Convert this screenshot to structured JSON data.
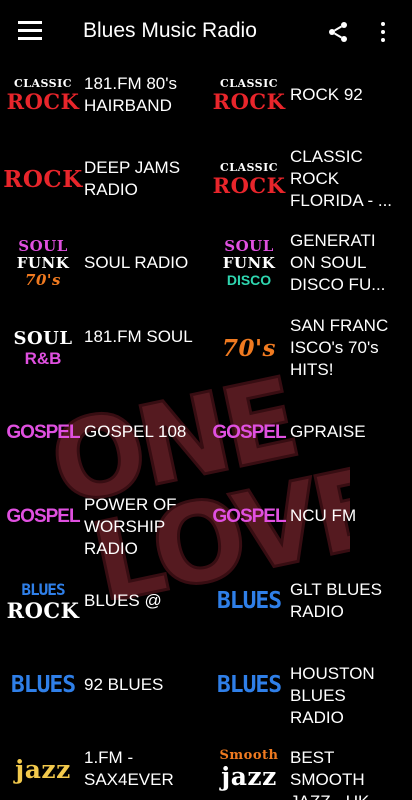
{
  "app": {
    "title": "Blues Music Radio"
  },
  "icons": {
    "menu": "hamburger-menu-icon",
    "share": "share-icon",
    "more": "more-vert-icon"
  },
  "watermark": {
    "text": "ONE LOVE"
  },
  "stations": [
    {
      "name": "181.FM 80's HAIRBAND",
      "logo": [
        "CLASSIC",
        "ROCK"
      ],
      "colors": [
        "#ffffff",
        "#e8252b"
      ]
    },
    {
      "name": "ROCK 92",
      "logo": [
        "CLASSIC",
        "ROCK"
      ],
      "colors": [
        "#ffffff",
        "#e8252b"
      ]
    },
    {
      "name": "DEEP JAMS RADIO",
      "logo": [
        "ROCK"
      ],
      "colors": [
        "#e8252b"
      ]
    },
    {
      "name": "CLASSIC ROCK FLORIDA - ...",
      "logo": [
        "CLASSIC",
        "ROCK"
      ],
      "colors": [
        "#ffffff",
        "#e8252b"
      ]
    },
    {
      "name": "SOUL RADIO",
      "logo": [
        "SOUL",
        "FUNK",
        "70's"
      ],
      "colors": [
        "#e050e0",
        "#ffffff",
        "#f07a20"
      ]
    },
    {
      "name": "GENERATI ON SOUL DISCO FU...",
      "logo": [
        "SOUL",
        "FUNK",
        "DISCO"
      ],
      "colors": [
        "#e050e0",
        "#ffffff",
        "#2fd6b0"
      ]
    },
    {
      "name": "181.FM SOUL",
      "logo": [
        "SOUL",
        "R&B"
      ],
      "colors": [
        "#ffffff",
        "#e050e0"
      ]
    },
    {
      "name": "SAN FRANC ISCO's 70's HITS!",
      "logo": [
        "70's"
      ],
      "colors": [
        "#f07a20"
      ]
    },
    {
      "name": "GOSPEL 108",
      "logo": [
        "GOSPEL"
      ],
      "colors": [
        "#e050e0"
      ]
    },
    {
      "name": "GPRAISE",
      "logo": [
        "GOSPEL"
      ],
      "colors": [
        "#e050e0"
      ]
    },
    {
      "name": "POWER OF WORSHIP RADIO",
      "logo": [
        "GOSPEL"
      ],
      "colors": [
        "#e050e0"
      ]
    },
    {
      "name": "NCU FM",
      "logo": [
        "GOSPEL"
      ],
      "colors": [
        "#e050e0"
      ]
    },
    {
      "name": "BLUES @",
      "logo": [
        "BLUES",
        "ROCK"
      ],
      "colors": [
        "#2f7fe8",
        "#ffffff"
      ]
    },
    {
      "name": "GLT BLUES RADIO",
      "logo": [
        "BLUES"
      ],
      "colors": [
        "#2f7fe8"
      ]
    },
    {
      "name": "92 BLUES",
      "logo": [
        "BLUES"
      ],
      "colors": [
        "#2f7fe8"
      ]
    },
    {
      "name": "HOUSTON BLUES RADIO",
      "logo": [
        "BLUES"
      ],
      "colors": [
        "#2f7fe8"
      ]
    },
    {
      "name": "1.FM - SAX4EVER",
      "logo": [
        "jazz"
      ],
      "colors": [
        "#f2c94c"
      ]
    },
    {
      "name": "BEST SMOOTH JAZZ - UK",
      "logo": [
        "Smooth",
        "jazz"
      ],
      "colors": [
        "#f07a20",
        "#ffffff"
      ]
    }
  ]
}
